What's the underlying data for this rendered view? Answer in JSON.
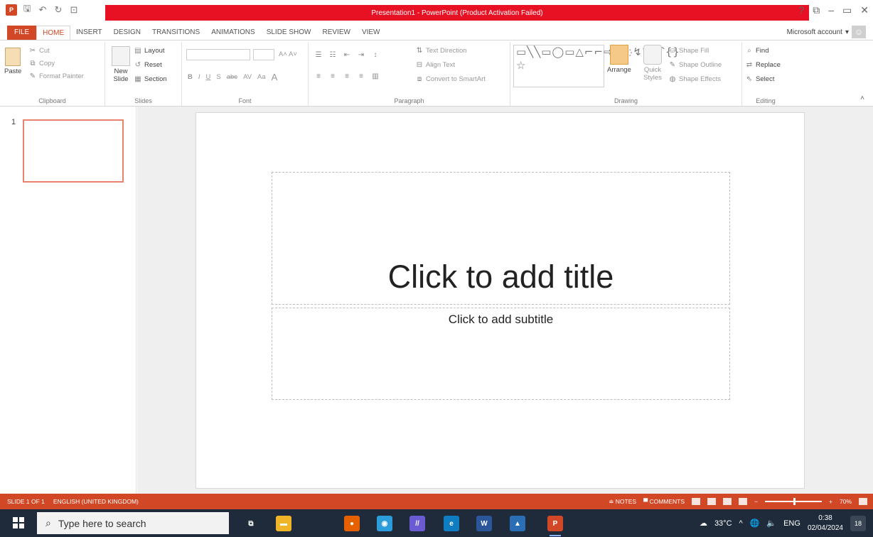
{
  "window": {
    "title": "Presentation1 - PowerPoint (Product Activation Failed)",
    "controls": [
      "?",
      "⧉",
      "–",
      "▭",
      "✕"
    ]
  },
  "tabs": [
    {
      "label": "FILE"
    },
    {
      "label": "HOME",
      "active": true
    },
    {
      "label": "INSERT"
    },
    {
      "label": "DESIGN"
    },
    {
      "label": "TRANSITIONS"
    },
    {
      "label": "ANIMATIONS"
    },
    {
      "label": "SLIDE SHOW"
    },
    {
      "label": "REVIEW"
    },
    {
      "label": "VIEW"
    }
  ],
  "account": {
    "label": "Microsoft account"
  },
  "ribbon": {
    "clipboard": {
      "label": "Clipboard",
      "paste": "Paste",
      "cut": "Cut",
      "copy": "Copy",
      "format_painter": "Format Painter"
    },
    "slides": {
      "label": "Slides",
      "new_slide": "New Slide",
      "layout": "Layout",
      "reset": "Reset",
      "section": "Section"
    },
    "font": {
      "label": "Font",
      "bold": "B",
      "italic": "I",
      "underline": "U",
      "strike": "S",
      "abc": "abc",
      "av": "AV",
      "aa": "Aa",
      "a_color": "A"
    },
    "paragraph": {
      "label": "Paragraph",
      "text_direction": "Text Direction",
      "align_text": "Align Text",
      "convert_smartart": "Convert to SmartArt"
    },
    "drawing": {
      "label": "Drawing",
      "shapes": "▭╲╲▭◯▭△⌐⌐⇨⇩◌↯⌒⌒{}☆",
      "arrange": "Arrange",
      "quick_styles": "Quick Styles",
      "shape_fill": "Shape Fill",
      "shape_outline": "Shape Outline",
      "shape_effects": "Shape Effects"
    },
    "editing": {
      "label": "Editing",
      "find": "Find",
      "replace": "Replace",
      "select": "Select"
    }
  },
  "thumbnails": [
    {
      "number": "1"
    }
  ],
  "slide": {
    "title_placeholder": "Click to add title",
    "subtitle_placeholder": "Click to add subtitle"
  },
  "statusbar": {
    "slide_info": "SLIDE 1 OF 1",
    "language": "ENGLISH (UNITED KINGDOM)",
    "notes": "NOTES",
    "comments": "COMMENTS",
    "zoom": "70%",
    "zoom_level": 0.7
  },
  "taskbar": {
    "search_placeholder": "Type here to search",
    "weather": "33°C",
    "lang": "ENG",
    "time": "0:38",
    "date": "02/04/2024",
    "notifications": "18",
    "apps": [
      {
        "name": "task-view",
        "glyph": "⧉",
        "color": "#1f2b3a"
      },
      {
        "name": "file-explorer",
        "glyph": "▬",
        "color": "#f0b429"
      },
      {
        "name": "firefox",
        "glyph": "●",
        "color": "#e66000"
      },
      {
        "name": "search-app",
        "glyph": "◉",
        "color": "#2d9cdb"
      },
      {
        "name": "purple-app",
        "glyph": "//",
        "color": "#6b5bd2"
      },
      {
        "name": "edge",
        "glyph": "e",
        "color": "#0f7dc2"
      },
      {
        "name": "word",
        "glyph": "W",
        "color": "#2b579a"
      },
      {
        "name": "photos",
        "glyph": "▲",
        "color": "#2a6fb5"
      },
      {
        "name": "powerpoint",
        "glyph": "P",
        "color": "#d24726",
        "active": true
      }
    ]
  }
}
